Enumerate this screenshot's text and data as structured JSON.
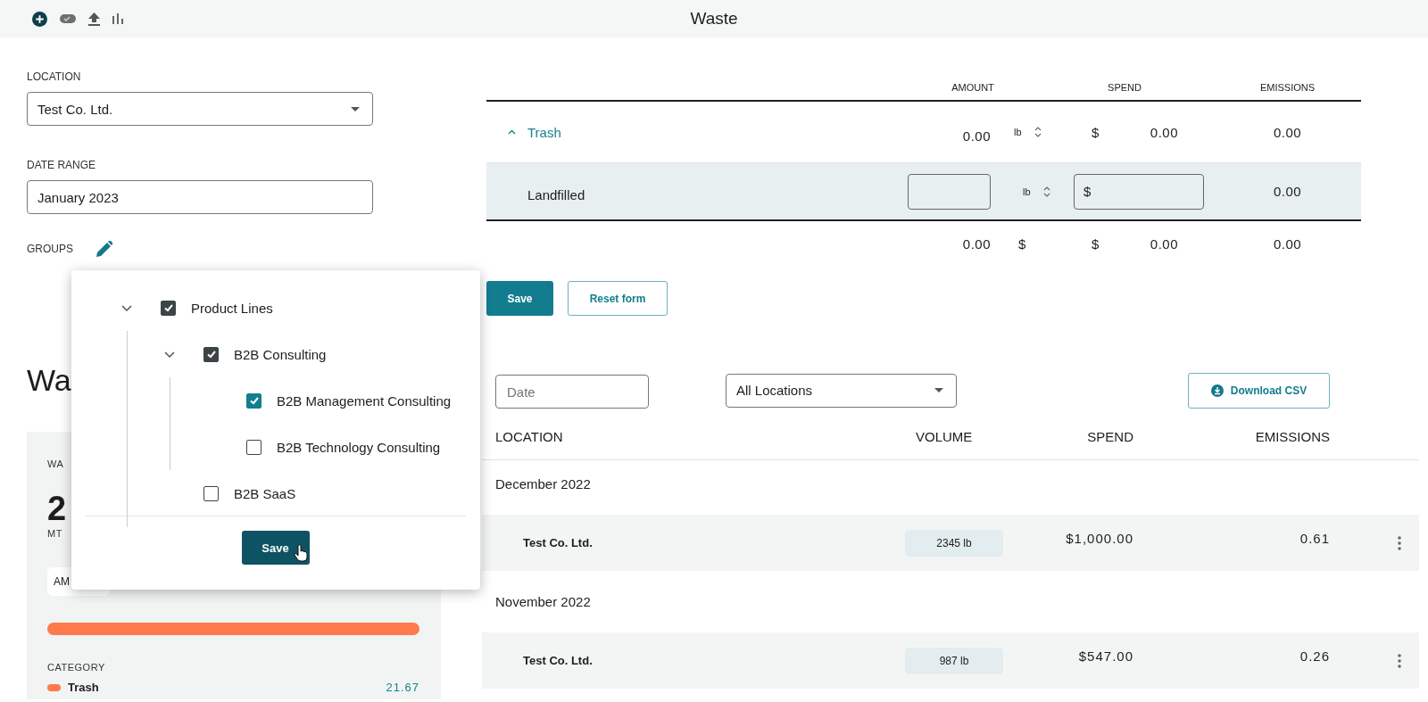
{
  "header": {
    "title": "Waste"
  },
  "filters": {
    "location": {
      "label": "LOCATION",
      "value": "Test Co. Ltd."
    },
    "date_range": {
      "label": "DATE RANGE",
      "value": "January 2023"
    },
    "groups": {
      "label": "GROUPS"
    }
  },
  "summary_card": {
    "heading": "Wa",
    "label": "WA",
    "value": "2",
    "unit": "MT",
    "tab": "AM",
    "category_heading": "CATEGORY",
    "categories": [
      {
        "name": "Trash",
        "value": "21.67",
        "color": "#ff7a4a"
      }
    ]
  },
  "groups_popup": {
    "tree": [
      {
        "label": "Product Lines",
        "checked": true,
        "expanded": true,
        "children": [
          {
            "label": "B2B Consulting",
            "checked": true,
            "expanded": true,
            "children": [
              {
                "label": "B2B Management Consulting",
                "checked": true
              },
              {
                "label": "B2B Technology Consulting",
                "checked": false
              }
            ]
          },
          {
            "label": "B2B SaaS",
            "checked": false
          }
        ]
      }
    ],
    "save_label": "Save"
  },
  "entry_table": {
    "columns": [
      "AMOUNT",
      "SPEND",
      "EMISSIONS"
    ],
    "rows": [
      {
        "kind": "category",
        "name": "Trash",
        "expanded": true,
        "amount": "0.00",
        "unit": "lb",
        "currency": "$",
        "spend": "0.00",
        "emissions": "0.00"
      },
      {
        "kind": "input",
        "name": "Landfilled",
        "unit": "lb",
        "currency": "$",
        "emissions": "0.00"
      }
    ],
    "totals": {
      "amount": "0.00",
      "unit": "$",
      "currency": "$",
      "spend": "0.00",
      "emissions": "0.00"
    }
  },
  "form_buttons": [
    {
      "label": "Save",
      "kind": "primary"
    },
    {
      "label": "Reset form",
      "kind": "secondary"
    }
  ],
  "history": {
    "date_filter": {
      "placeholder": "Date"
    },
    "location_filter": {
      "value": "All Locations"
    },
    "download_label": "Download CSV",
    "columns": [
      "LOCATION",
      "VOLUME",
      "SPEND",
      "EMISSIONS"
    ],
    "groups": [
      {
        "month": "December 2022",
        "rows": [
          {
            "location": "Test Co. Ltd.",
            "volume": "2345 lb",
            "spend": "$1,000.00",
            "emissions": "0.61"
          }
        ]
      },
      {
        "month": "November 2022",
        "rows": [
          {
            "location": "Test Co. Ltd.",
            "volume": "987 lb",
            "spend": "$547.00",
            "emissions": "0.26"
          }
        ]
      }
    ]
  }
}
